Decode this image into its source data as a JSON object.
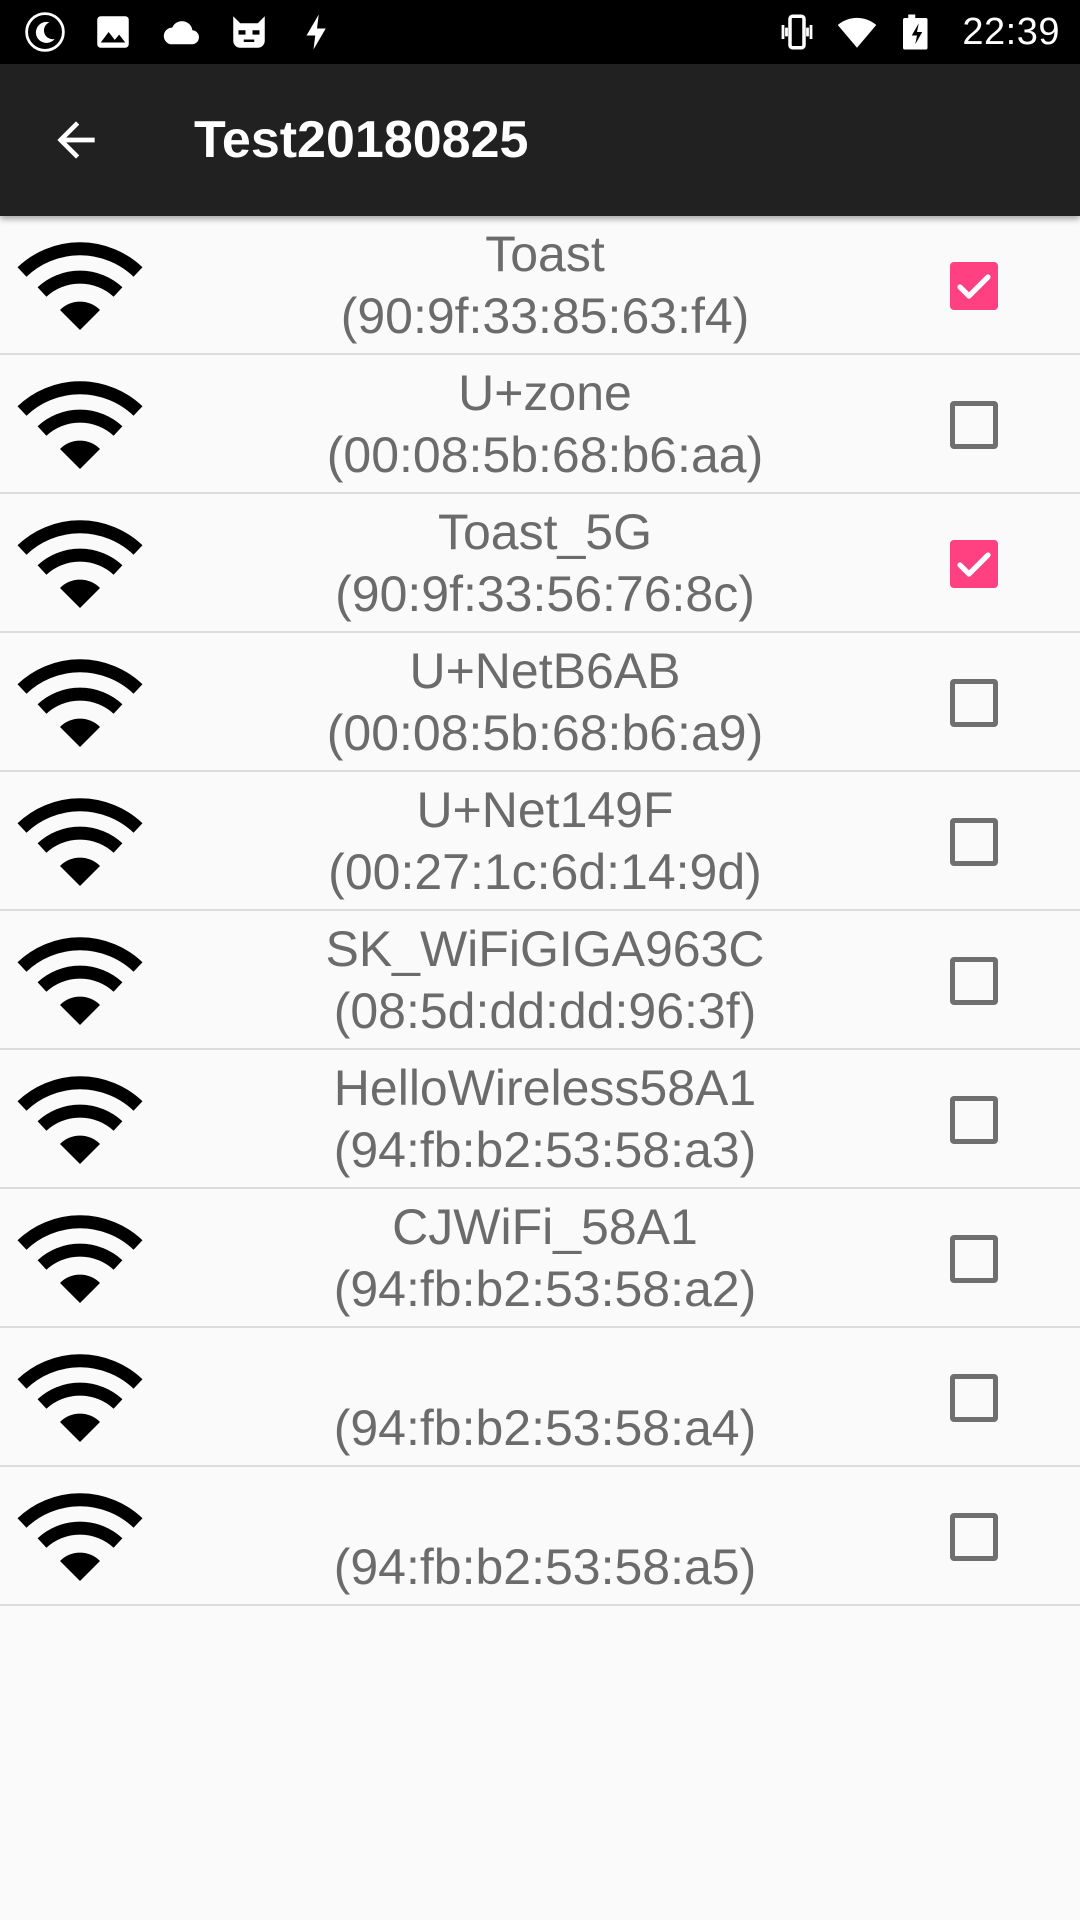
{
  "status_bar": {
    "time": "22:39",
    "left_icons": [
      "moon-icon",
      "image-icon",
      "cloud-icon",
      "cat-icon",
      "bolt-icon"
    ],
    "right_icons": [
      "vibrate-icon",
      "wifi-signal-icon",
      "battery-charging-icon"
    ]
  },
  "app_bar": {
    "title": "Test20180825",
    "back_icon": "arrow-back-icon"
  },
  "colors": {
    "accent": "#ff4081",
    "app_bar": "#212121",
    "status_bar": "#000000",
    "background": "#fafafa",
    "text": "#6b6b6b"
  },
  "networks": [
    {
      "ssid": "Toast",
      "bssid": "(90:9f:33:85:63:f4)",
      "checked": true
    },
    {
      "ssid": "U+zone",
      "bssid": "(00:08:5b:68:b6:aa)",
      "checked": false
    },
    {
      "ssid": "Toast_5G",
      "bssid": "(90:9f:33:56:76:8c)",
      "checked": true
    },
    {
      "ssid": "U+NetB6AB",
      "bssid": "(00:08:5b:68:b6:a9)",
      "checked": false
    },
    {
      "ssid": "U+Net149F",
      "bssid": "(00:27:1c:6d:14:9d)",
      "checked": false
    },
    {
      "ssid": "SK_WiFiGIGA963C",
      "bssid": "(08:5d:dd:dd:96:3f)",
      "checked": false
    },
    {
      "ssid": "HelloWireless58A1",
      "bssid": "(94:fb:b2:53:58:a3)",
      "checked": false
    },
    {
      "ssid": "CJWiFi_58A1",
      "bssid": "(94:fb:b2:53:58:a2)",
      "checked": false
    },
    {
      "ssid": "",
      "bssid": "(94:fb:b2:53:58:a4)",
      "checked": false
    },
    {
      "ssid": "",
      "bssid": "(94:fb:b2:53:58:a5)",
      "checked": false
    }
  ]
}
